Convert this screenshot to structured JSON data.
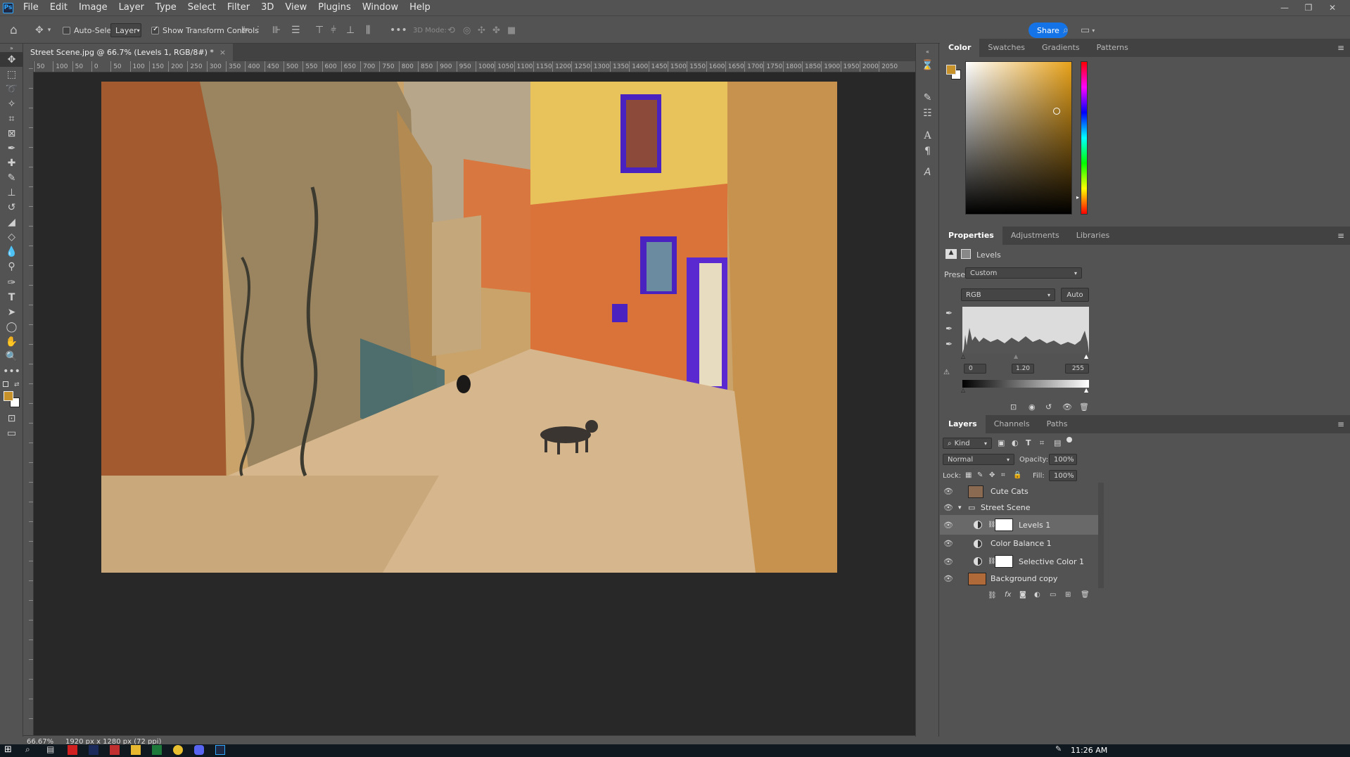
{
  "menubar": {
    "logo": "Ps",
    "items": [
      "File",
      "Edit",
      "Image",
      "Layer",
      "Type",
      "Select",
      "Filter",
      "3D",
      "View",
      "Plugins",
      "Window",
      "Help"
    ]
  },
  "options": {
    "auto_select_label": "Auto-Select:",
    "auto_select_target": "Layer",
    "show_transform_label": "Show Transform Controls",
    "mode_3d_label": "3D Mode:",
    "share_label": "Share"
  },
  "document": {
    "tab_title": "Street Scene.jpg @ 66.7% (Levels 1, RGB/8#) *",
    "zoom": "66.67%",
    "dimensions": "1920 px x 1280 px (72 ppi)"
  },
  "ruler_h": [
    "50",
    "100",
    "50",
    "0",
    "50",
    "100",
    "150",
    "200",
    "250",
    "300",
    "350",
    "400",
    "450",
    "500",
    "550",
    "600",
    "650",
    "700",
    "750",
    "800",
    "850",
    "900",
    "950",
    "1000",
    "1050",
    "1100",
    "1150",
    "1200",
    "1250",
    "1300",
    "1350",
    "1400",
    "1450",
    "1500",
    "1550",
    "1600",
    "1650",
    "1700",
    "1750",
    "1800",
    "1850",
    "1900",
    "1950",
    "2000",
    "2050"
  ],
  "color_panel": {
    "tabs": [
      "Color",
      "Swatches",
      "Gradients",
      "Patterns"
    ],
    "foreground": "#c8922a",
    "background": "#ffffff"
  },
  "properties_panel": {
    "tabs": [
      "Properties",
      "Adjustments",
      "Libraries"
    ],
    "layer_type": "Levels",
    "preset_label": "Preset:",
    "preset_value": "Custom",
    "channel": "RGB",
    "auto_label": "Auto",
    "input_black": "0",
    "input_gamma": "1.20",
    "input_white": "255"
  },
  "layers_panel": {
    "tabs": [
      "Layers",
      "Channels",
      "Paths"
    ],
    "filter_kind": "Kind",
    "blend_mode": "Normal",
    "opacity_label": "Opacity:",
    "opacity_value": "100%",
    "lock_label": "Lock:",
    "fill_label": "Fill:",
    "fill_value": "100%",
    "layers": [
      {
        "name": "Cute Cats"
      },
      {
        "name": "Street Scene"
      },
      {
        "name": "Levels 1"
      },
      {
        "name": "Color Balance 1"
      },
      {
        "name": "Selective Color 1"
      },
      {
        "name": "Background copy"
      }
    ]
  },
  "taskbar": {
    "time": "11:26 AM"
  }
}
